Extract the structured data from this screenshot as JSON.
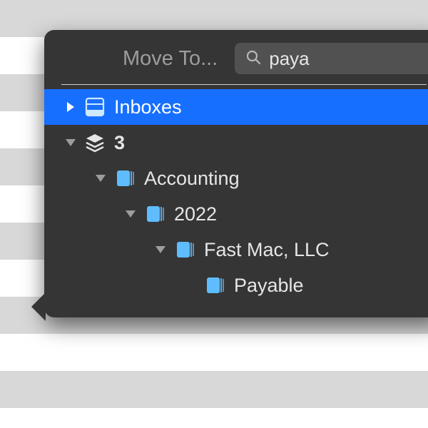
{
  "colors": {
    "popover_bg": "#353535",
    "selection": "#176fff",
    "folder_icon": "#5fbcff",
    "text": "#e6e6e6",
    "muted": "#9d9d9d"
  },
  "header": {
    "title": "Move To...",
    "search_value": "paya"
  },
  "tree": [
    {
      "label": "Inboxes",
      "icon": "inbox",
      "depth": 0,
      "expanded": false,
      "selected": true,
      "has_children": true,
      "bold": false
    },
    {
      "label": "3",
      "icon": "stack",
      "depth": 0,
      "expanded": true,
      "selected": false,
      "has_children": true,
      "bold": true
    },
    {
      "label": "Accounting",
      "icon": "folder",
      "depth": 1,
      "expanded": true,
      "selected": false,
      "has_children": true,
      "bold": false
    },
    {
      "label": "2022",
      "icon": "folder",
      "depth": 2,
      "expanded": true,
      "selected": false,
      "has_children": true,
      "bold": false
    },
    {
      "label": "Fast Mac, LLC",
      "icon": "folder",
      "depth": 3,
      "expanded": true,
      "selected": false,
      "has_children": true,
      "bold": false
    },
    {
      "label": "Payable",
      "icon": "folder",
      "depth": 4,
      "expanded": false,
      "selected": false,
      "has_children": false,
      "bold": false
    }
  ]
}
